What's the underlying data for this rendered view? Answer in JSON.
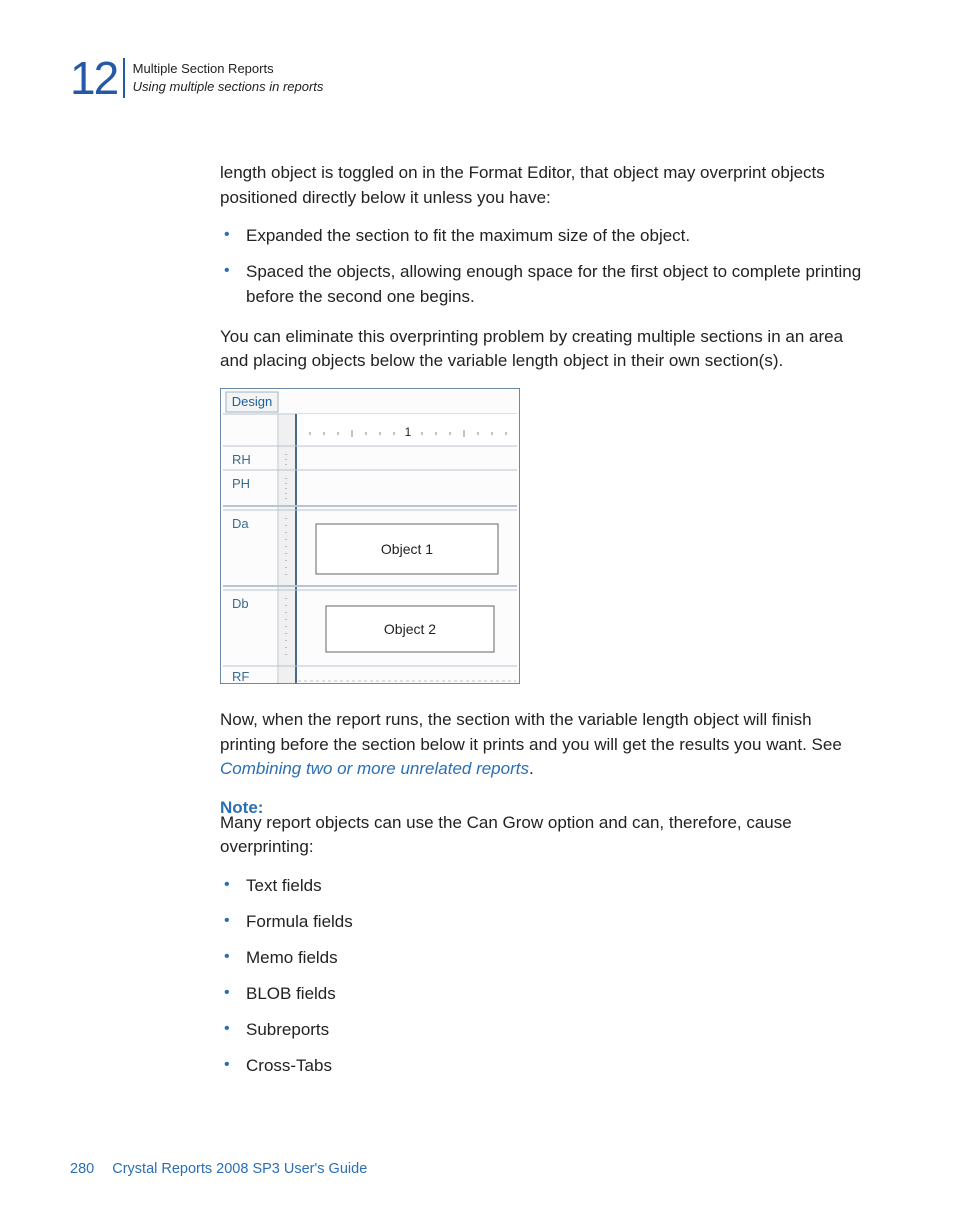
{
  "chapter": {
    "number": "12",
    "title": "Multiple Section Reports",
    "subtitle": "Using multiple sections in reports"
  },
  "body": {
    "intro_para": "length object is toggled on in the Format Editor, that object may overprint objects positioned directly below it unless you have:",
    "bullets_a": [
      "Expanded the section to fit the maximum size of the object.",
      "Spaced the objects, allowing enough space for the first object to complete printing before the second one begins."
    ],
    "para2": "You can eliminate this overprinting problem by creating multiple sections in an area and placing objects below the variable length object in their own section(s).",
    "para3_prefix": "Now, when the report runs, the section with the variable length object will finish printing before the section below it prints and you will get the results you want. See ",
    "para3_link": "Combining two or more unrelated reports",
    "para3_suffix": ".",
    "note_label": "Note:",
    "note_para": "Many report objects can use the Can Grow option and can, therefore, cause overprinting:",
    "bullets_b": [
      "Text fields",
      "Formula fields",
      "Memo fields",
      "BLOB fields",
      "Subreports",
      "Cross-Tabs"
    ]
  },
  "diagram": {
    "tab": "Design",
    "ruler_mark": "1",
    "sections": {
      "rh": "RH",
      "ph": "PH",
      "da": "Da",
      "db": "Db",
      "rf": "RF"
    },
    "object1": "Object 1",
    "object2": "Object 2"
  },
  "footer": {
    "page": "280",
    "book": "Crystal Reports 2008 SP3 User's Guide"
  }
}
